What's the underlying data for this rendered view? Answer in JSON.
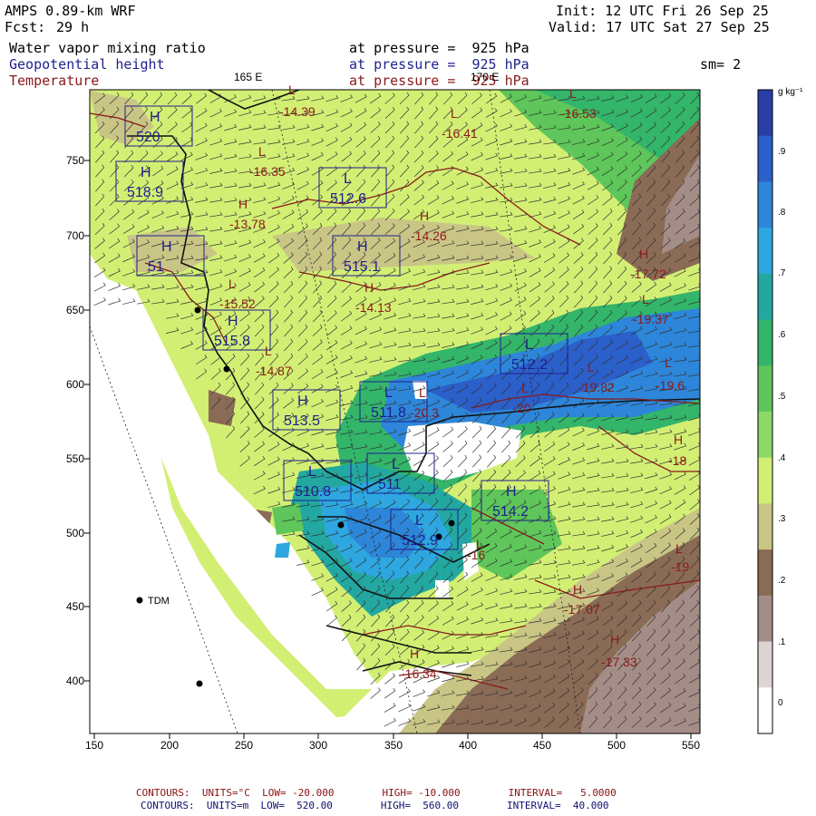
{
  "header": {
    "model": "AMPS 0.89-km WRF",
    "forecast_label": "Fcst:",
    "forecast_value": "29 h",
    "init": "Init: 12 UTC Fri 26 Sep 25",
    "valid": "Valid: 17 UTC Sat 27 Sep 25",
    "fields": [
      {
        "name": "Water vapor mixing ratio",
        "level": "at pressure =  925 hPa"
      },
      {
        "name": "Geopotential height",
        "level": "at pressure =  925 hPa"
      },
      {
        "name": "Temperature",
        "level": "at pressure =  925 hPa"
      }
    ],
    "smoothing": "sm= 2"
  },
  "map": {
    "meridian_labels": [
      "165 E",
      "170 E"
    ],
    "x_ticks": [
      "150",
      "200",
      "250",
      "300",
      "350",
      "400",
      "450",
      "500",
      "550"
    ],
    "y_ticks": [
      "750",
      "700",
      "650",
      "600",
      "550",
      "500",
      "450",
      "400"
    ],
    "stations": [
      {
        "label": "TDM"
      }
    ],
    "geopotential_labels": [
      {
        "type": "H",
        "value": "520"
      },
      {
        "type": "H",
        "value": "518.9"
      },
      {
        "type": "H",
        "value": "51"
      },
      {
        "type": "H",
        "value": "515.8"
      },
      {
        "type": "L",
        "value": "512.6"
      },
      {
        "type": "H",
        "value": "515.1"
      },
      {
        "type": "L",
        "value": "512.2"
      },
      {
        "type": "H",
        "value": "513.5"
      },
      {
        "type": "L",
        "value": "511.8"
      },
      {
        "type": "L",
        "value": "510.8"
      },
      {
        "type": "L",
        "value": "511"
      },
      {
        "type": "H",
        "value": "514.2"
      },
      {
        "type": "L",
        "value": "512.9"
      }
    ],
    "temperature_labels": [
      {
        "type": "L",
        "value": "-14.39"
      },
      {
        "type": "L",
        "value": "-16.53"
      },
      {
        "type": "L",
        "value": "-16.41"
      },
      {
        "type": "L",
        "value": "-16.35"
      },
      {
        "type": "H",
        "value": "-13.78"
      },
      {
        "type": "H",
        "value": "-14.26"
      },
      {
        "type": "H",
        "value": "-14.13"
      },
      {
        "type": "L",
        "value": "-15.52"
      },
      {
        "type": "H",
        "value": "-17.72"
      },
      {
        "type": "L",
        "value": "-19.37"
      },
      {
        "type": "L",
        "value": "-14.87"
      },
      {
        "type": "L",
        "value": "-19.82"
      },
      {
        "type": "L",
        "value": "-19.6"
      },
      {
        "type": "L",
        "value": "-20.3"
      },
      {
        "type": "L",
        "value": "-20"
      },
      {
        "type": "H",
        "value": "-18"
      },
      {
        "type": "L",
        "value": "-19"
      },
      {
        "type": "H",
        "value": "-17.07"
      },
      {
        "type": "H",
        "value": "-16.34"
      },
      {
        "type": "H",
        "value": "-17.33"
      },
      {
        "type": "L",
        "value": "-16"
      }
    ]
  },
  "colorbar": {
    "units": "g kg⁻¹",
    "labels": [
      ".9",
      ".8",
      ".7",
      ".6",
      ".5",
      ".4",
      ".3",
      ".2",
      ".1",
      "0"
    ],
    "colors": [
      "#2a3ea8",
      "#2b5fc9",
      "#2d86d9",
      "#2ea7e0",
      "#22a8a0",
      "#33b56a",
      "#5ec65a",
      "#8ed867",
      "#d2ef74",
      "#c9c585",
      "#8a6b55",
      "#a58d87",
      "#dcd5d3",
      "#ffffff"
    ]
  },
  "footer": {
    "temp_contours": "CONTOURS:  UNITS=°C  LOW= -20.000        HIGH= -10.000        INTERVAL=   5.0000",
    "height_contours": "CONTOURS:  UNITS=m  LOW=  520.00        HIGH=  560.00        INTERVAL=  40.000"
  },
  "colors": {
    "height_contour": "#111111",
    "temp_contour": "#8a1a1a",
    "geo_label": "#1f1f8f",
    "temp_label": "#8a1a1a"
  }
}
